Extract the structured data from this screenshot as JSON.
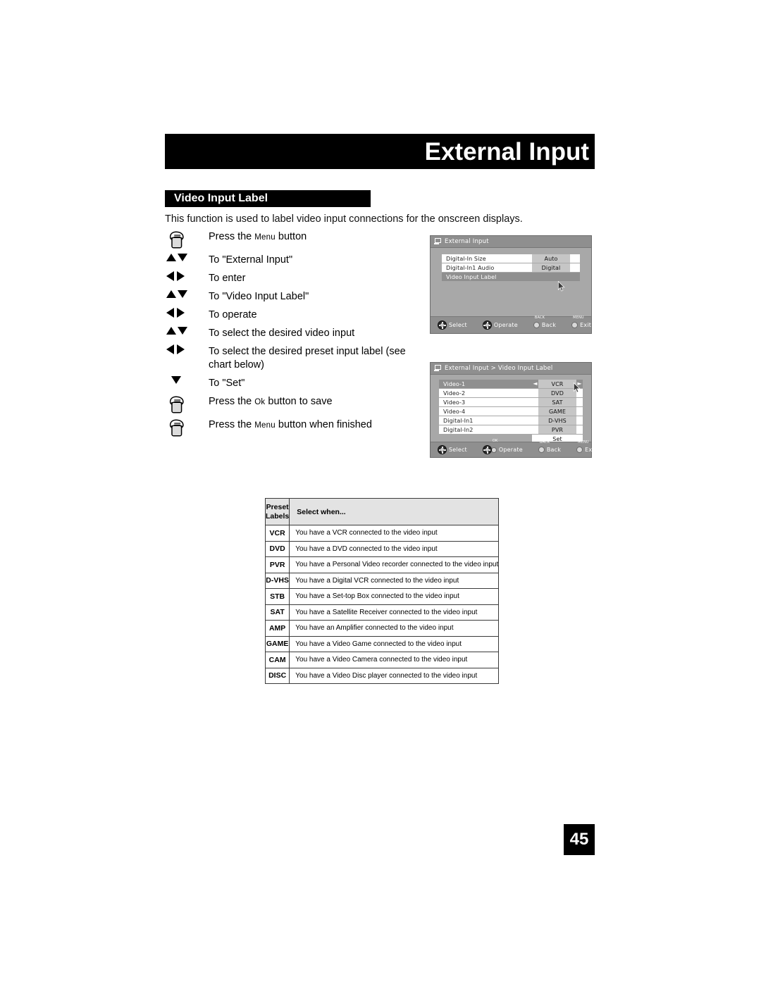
{
  "page": {
    "banner_title": "External Input",
    "section_heading": "Video Input Label",
    "intro": "This function is used to label video input connections for the onscreen displays.",
    "page_number": "45"
  },
  "steps": [
    {
      "icon": "press-button-icon",
      "prefix": "Press the ",
      "smallcaps": "Menu",
      "suffix": " button"
    },
    {
      "icon": "up-down-arrows-icon",
      "prefix": "To \"External Input\"",
      "smallcaps": "",
      "suffix": ""
    },
    {
      "icon": "left-right-arrows-icon",
      "prefix": "To enter",
      "smallcaps": "",
      "suffix": ""
    },
    {
      "icon": "up-down-arrows-icon",
      "prefix": "To \"Video Input Label\"",
      "smallcaps": "",
      "suffix": ""
    },
    {
      "icon": "left-right-arrows-icon",
      "prefix": "To operate",
      "smallcaps": "",
      "suffix": ""
    },
    {
      "icon": "up-down-arrows-icon",
      "prefix": "To select the desired video input",
      "smallcaps": "",
      "suffix": ""
    },
    {
      "icon": "left-right-arrows-icon",
      "prefix": "To select the desired preset input label (see chart below)",
      "smallcaps": "",
      "suffix": ""
    },
    {
      "icon": "down-arrow-icon",
      "prefix": "To \"Set\"",
      "smallcaps": "",
      "suffix": ""
    },
    {
      "icon": "press-button-icon",
      "prefix": "Press the ",
      "smallcaps": "Ok",
      "suffix": " button to save"
    },
    {
      "icon": "press-button-icon",
      "prefix": "Press the ",
      "smallcaps": "Menu",
      "suffix": " button when finished"
    }
  ],
  "osd_external_input": {
    "title": "External Input",
    "rows": [
      {
        "label": "Digital-In Size",
        "value": "Auto",
        "selected": false
      },
      {
        "label": "Digital-In1 Audio",
        "value": "Digital",
        "selected": false
      },
      {
        "label": "Video Input Label",
        "value": "",
        "selected": true
      }
    ],
    "footer": [
      {
        "tag": "",
        "label": "Select",
        "control": "dpad"
      },
      {
        "tag": "",
        "label": "Operate",
        "control": "dpad"
      },
      {
        "tag": "BACK",
        "label": "Back",
        "control": "button"
      },
      {
        "tag": "MENU",
        "label": "Exit",
        "control": "button"
      }
    ]
  },
  "osd_video_input_label": {
    "title": "External Input > Video Input Label",
    "rows": [
      {
        "label": "Video-1",
        "value": "VCR",
        "selected": true
      },
      {
        "label": "Video-2",
        "value": "DVD",
        "selected": false
      },
      {
        "label": "Video-3",
        "value": "SAT",
        "selected": false
      },
      {
        "label": "Video-4",
        "value": "GAME",
        "selected": false
      },
      {
        "label": "Digital-In1",
        "value": "D-VHS",
        "selected": false
      },
      {
        "label": "Digital-In2",
        "value": "PVR",
        "selected": false
      }
    ],
    "set_label": "Set",
    "footer": [
      {
        "tag": "",
        "label": "Select",
        "control": "dpad"
      },
      {
        "tag": "OK",
        "label": "Operate",
        "control": "dpad-ok"
      },
      {
        "tag": "BACK",
        "label": "Back",
        "control": "button"
      },
      {
        "tag": "MENU",
        "label": "Exit",
        "control": "button"
      }
    ]
  },
  "preset_table": {
    "headers": {
      "col1_line1": "Preset",
      "col1_line2": "Labels",
      "col2": "Select when..."
    },
    "rows": [
      {
        "label": "VCR",
        "desc": "You have a VCR connected to the video input"
      },
      {
        "label": "DVD",
        "desc": "You have a DVD connected to the video input"
      },
      {
        "label": "PVR",
        "desc": "You have a Personal Video recorder connected to the video input"
      },
      {
        "label": "D-VHS",
        "desc": "You have a Digital VCR connected to the video input"
      },
      {
        "label": "STB",
        "desc": "You have a Set-top Box connected to the video input"
      },
      {
        "label": "SAT",
        "desc": "You have a Satellite Receiver connected to the video input"
      },
      {
        "label": "AMP",
        "desc": "You have an Amplifier connected to the video input"
      },
      {
        "label": "GAME",
        "desc": "You have a Video Game connected to the video input"
      },
      {
        "label": "CAM",
        "desc": "You have a Video Camera connected to the video input"
      },
      {
        "label": "DISC",
        "desc": "You have a Video Disc player connected to the video input"
      }
    ]
  },
  "colors": {
    "banner": "#000000",
    "osd_bg": "#a8a8a8",
    "osd_bar": "#8f8f8f",
    "osd_value": "#c6c6c6",
    "table_header": "#e3e3e3"
  }
}
